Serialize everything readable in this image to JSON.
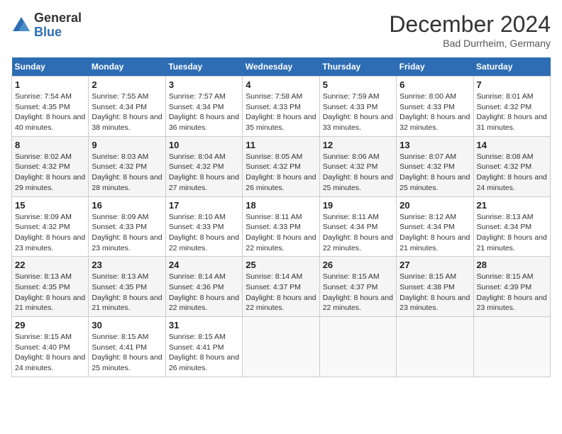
{
  "header": {
    "logo_general": "General",
    "logo_blue": "Blue",
    "title": "December 2024",
    "subtitle": "Bad Durrheim, Germany"
  },
  "days_of_week": [
    "Sunday",
    "Monday",
    "Tuesday",
    "Wednesday",
    "Thursday",
    "Friday",
    "Saturday"
  ],
  "weeks": [
    [
      {
        "day": "1",
        "sunrise": "Sunrise: 7:54 AM",
        "sunset": "Sunset: 4:35 PM",
        "daylight": "Daylight: 8 hours and 40 minutes."
      },
      {
        "day": "2",
        "sunrise": "Sunrise: 7:55 AM",
        "sunset": "Sunset: 4:34 PM",
        "daylight": "Daylight: 8 hours and 38 minutes."
      },
      {
        "day": "3",
        "sunrise": "Sunrise: 7:57 AM",
        "sunset": "Sunset: 4:34 PM",
        "daylight": "Daylight: 8 hours and 36 minutes."
      },
      {
        "day": "4",
        "sunrise": "Sunrise: 7:58 AM",
        "sunset": "Sunset: 4:33 PM",
        "daylight": "Daylight: 8 hours and 35 minutes."
      },
      {
        "day": "5",
        "sunrise": "Sunrise: 7:59 AM",
        "sunset": "Sunset: 4:33 PM",
        "daylight": "Daylight: 8 hours and 33 minutes."
      },
      {
        "day": "6",
        "sunrise": "Sunrise: 8:00 AM",
        "sunset": "Sunset: 4:33 PM",
        "daylight": "Daylight: 8 hours and 32 minutes."
      },
      {
        "day": "7",
        "sunrise": "Sunrise: 8:01 AM",
        "sunset": "Sunset: 4:32 PM",
        "daylight": "Daylight: 8 hours and 31 minutes."
      }
    ],
    [
      {
        "day": "8",
        "sunrise": "Sunrise: 8:02 AM",
        "sunset": "Sunset: 4:32 PM",
        "daylight": "Daylight: 8 hours and 29 minutes."
      },
      {
        "day": "9",
        "sunrise": "Sunrise: 8:03 AM",
        "sunset": "Sunset: 4:32 PM",
        "daylight": "Daylight: 8 hours and 28 minutes."
      },
      {
        "day": "10",
        "sunrise": "Sunrise: 8:04 AM",
        "sunset": "Sunset: 4:32 PM",
        "daylight": "Daylight: 8 hours and 27 minutes."
      },
      {
        "day": "11",
        "sunrise": "Sunrise: 8:05 AM",
        "sunset": "Sunset: 4:32 PM",
        "daylight": "Daylight: 8 hours and 26 minutes."
      },
      {
        "day": "12",
        "sunrise": "Sunrise: 8:06 AM",
        "sunset": "Sunset: 4:32 PM",
        "daylight": "Daylight: 8 hours and 25 minutes."
      },
      {
        "day": "13",
        "sunrise": "Sunrise: 8:07 AM",
        "sunset": "Sunset: 4:32 PM",
        "daylight": "Daylight: 8 hours and 25 minutes."
      },
      {
        "day": "14",
        "sunrise": "Sunrise: 8:08 AM",
        "sunset": "Sunset: 4:32 PM",
        "daylight": "Daylight: 8 hours and 24 minutes."
      }
    ],
    [
      {
        "day": "15",
        "sunrise": "Sunrise: 8:09 AM",
        "sunset": "Sunset: 4:32 PM",
        "daylight": "Daylight: 8 hours and 23 minutes."
      },
      {
        "day": "16",
        "sunrise": "Sunrise: 8:09 AM",
        "sunset": "Sunset: 4:33 PM",
        "daylight": "Daylight: 8 hours and 23 minutes."
      },
      {
        "day": "17",
        "sunrise": "Sunrise: 8:10 AM",
        "sunset": "Sunset: 4:33 PM",
        "daylight": "Daylight: 8 hours and 22 minutes."
      },
      {
        "day": "18",
        "sunrise": "Sunrise: 8:11 AM",
        "sunset": "Sunset: 4:33 PM",
        "daylight": "Daylight: 8 hours and 22 minutes."
      },
      {
        "day": "19",
        "sunrise": "Sunrise: 8:11 AM",
        "sunset": "Sunset: 4:34 PM",
        "daylight": "Daylight: 8 hours and 22 minutes."
      },
      {
        "day": "20",
        "sunrise": "Sunrise: 8:12 AM",
        "sunset": "Sunset: 4:34 PM",
        "daylight": "Daylight: 8 hours and 21 minutes."
      },
      {
        "day": "21",
        "sunrise": "Sunrise: 8:13 AM",
        "sunset": "Sunset: 4:34 PM",
        "daylight": "Daylight: 8 hours and 21 minutes."
      }
    ],
    [
      {
        "day": "22",
        "sunrise": "Sunrise: 8:13 AM",
        "sunset": "Sunset: 4:35 PM",
        "daylight": "Daylight: 8 hours and 21 minutes."
      },
      {
        "day": "23",
        "sunrise": "Sunrise: 8:13 AM",
        "sunset": "Sunset: 4:35 PM",
        "daylight": "Daylight: 8 hours and 21 minutes."
      },
      {
        "day": "24",
        "sunrise": "Sunrise: 8:14 AM",
        "sunset": "Sunset: 4:36 PM",
        "daylight": "Daylight: 8 hours and 22 minutes."
      },
      {
        "day": "25",
        "sunrise": "Sunrise: 8:14 AM",
        "sunset": "Sunset: 4:37 PM",
        "daylight": "Daylight: 8 hours and 22 minutes."
      },
      {
        "day": "26",
        "sunrise": "Sunrise: 8:15 AM",
        "sunset": "Sunset: 4:37 PM",
        "daylight": "Daylight: 8 hours and 22 minutes."
      },
      {
        "day": "27",
        "sunrise": "Sunrise: 8:15 AM",
        "sunset": "Sunset: 4:38 PM",
        "daylight": "Daylight: 8 hours and 23 minutes."
      },
      {
        "day": "28",
        "sunrise": "Sunrise: 8:15 AM",
        "sunset": "Sunset: 4:39 PM",
        "daylight": "Daylight: 8 hours and 23 minutes."
      }
    ],
    [
      {
        "day": "29",
        "sunrise": "Sunrise: 8:15 AM",
        "sunset": "Sunset: 4:40 PM",
        "daylight": "Daylight: 8 hours and 24 minutes."
      },
      {
        "day": "30",
        "sunrise": "Sunrise: 8:15 AM",
        "sunset": "Sunset: 4:41 PM",
        "daylight": "Daylight: 8 hours and 25 minutes."
      },
      {
        "day": "31",
        "sunrise": "Sunrise: 8:15 AM",
        "sunset": "Sunset: 4:41 PM",
        "daylight": "Daylight: 8 hours and 26 minutes."
      },
      null,
      null,
      null,
      null
    ]
  ]
}
